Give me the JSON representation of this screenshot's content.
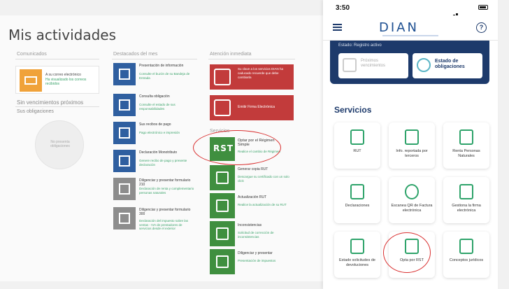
{
  "desktop": {
    "title": "Mis actividades",
    "col1_header": "Comunicados",
    "col2_header": "Destacados del mes",
    "col3_header": "Atención inmediata",
    "comunicado": {
      "title": "A su correo electrónico",
      "text": "Ha visualizado los correos recibidos"
    },
    "sin_vencimientos": "Sin vencimientos próximos",
    "sus_obligaciones": "Sus obligaciones",
    "empty_circle": "No presenta obligaciones",
    "tiles": [
      {
        "title": "Presentación de información",
        "text": "Consulte el buzón de su Bandeja de Entrada"
      },
      {
        "title": "Consulta obligación",
        "text": "Consulte el estado de sus responsabilidades"
      },
      {
        "title": "Sus recibos de pago",
        "text": "Pago electrónico e impresión"
      },
      {
        "title": "Declaración Monotributo",
        "text": "Genere recibo de pago y presente declaración"
      },
      {
        "title": "Diligenciar y presentar formulario 210",
        "text": "Declaración de renta y complementario personas naturales"
      },
      {
        "title": "Diligenciar y presentar formulario 300",
        "text": "Declaración del impuesto sobre las ventas - IVA de prestadores de servicios desde el exterior"
      }
    ],
    "alert1": "Su clave a los servicios DIAN ha caducado recuerde que debe cambiarla",
    "alert2": "Emitir Firma Electrónica",
    "servicios_label": "Servicios",
    "rst": {
      "badge": "RST",
      "title": "Optar por el Régimen Simple",
      "text": "Realice el cambio de Régimen"
    },
    "right_tiles": [
      {
        "title": "Generar copia RUT",
        "text": "Descargue su certificado con un solo click"
      },
      {
        "title": "Actualización RUT",
        "text": "Realice la actualización de su RUT"
      },
      {
        "title": "Inconsistencias",
        "text": "Solicitud de corrección de inconsistencias"
      },
      {
        "title": "Diligenciar y presentar",
        "text": "Presentación de impuestos"
      }
    ]
  },
  "phone": {
    "time": "3:50",
    "logo": "DIAN",
    "help": "?",
    "estado_label": "Estado: Registro activo",
    "card_vencimientos": "Próximos vencimientos",
    "card_obligaciones": "Estado de obligaciones",
    "servicios_title": "Servicios",
    "services": [
      "RUT",
      "Info. reportada por terceros",
      "Renta Personas Naturales",
      "Declaraciones",
      "Escanea QR de Factura electrónica",
      "Gestiona la firma electrónica",
      "Estado solicitudes de devoluciones",
      "Opta por RST",
      "Conceptos jurídicos"
    ]
  },
  "colors": {
    "dian_blue": "#1d3a6b",
    "green": "#2ea36a",
    "red": "#c23b3b",
    "orange": "#f0a23a",
    "highlight": "#d93030"
  }
}
